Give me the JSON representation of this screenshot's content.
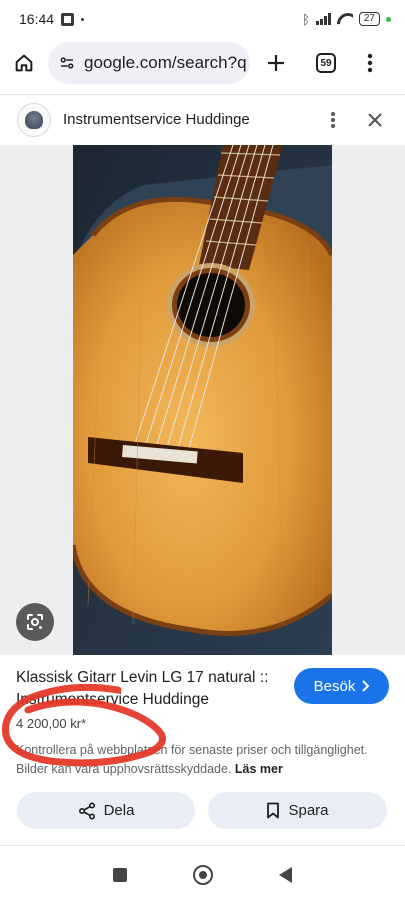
{
  "status_bar": {
    "time": "16:44",
    "battery": "27",
    "icons": [
      "gallery-icon",
      "dot-icon",
      "bluetooth-icon",
      "signal-icon",
      "wifi-icon",
      "battery-icon"
    ]
  },
  "browser": {
    "url": "google.com/search?q",
    "tab_count": "59",
    "icons": [
      "home-icon",
      "site-info-icon",
      "plus-icon",
      "tabs-icon",
      "more-vert-icon"
    ]
  },
  "source": {
    "name": "Instrumentservice Huddinge",
    "icons": [
      "favicon",
      "more-vert-icon",
      "close-icon"
    ]
  },
  "result": {
    "title": "Klassisk Gitarr Levin LG 17 natural :: Instrumentservice Huddinge",
    "visit_label": "Besök",
    "price": "4 200,00 kr*",
    "disclaimer": "Kontrollera på webbplatsen för senaste priser och tillgänglighet. Bilder kan vara upphovsrättsskyddade.",
    "read_more": "Läs mer"
  },
  "actions": {
    "share_label": "Dela",
    "save_label": "Spara"
  },
  "colors": {
    "accent": "#1a73e8",
    "annotation": "#e53323",
    "chip_bg": "#e9eef6"
  }
}
